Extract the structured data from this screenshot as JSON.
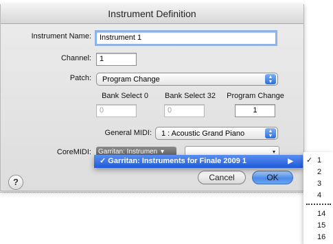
{
  "dialog": {
    "title": "Instrument Definition",
    "instrument_name_label": "Instrument Name:",
    "instrument_name_value": "Instrument 1",
    "channel_label": "Channel:",
    "channel_value": "1",
    "patch_label": "Patch:",
    "patch_value": "Program Change",
    "bank_select0_label": "Bank Select 0",
    "bank_select0_value": "0",
    "bank_select32_label": "Bank Select 32",
    "bank_select32_value": "0",
    "program_change_label": "Program Change",
    "program_change_value": "1",
    "general_midi_label": "General MIDI:",
    "general_midi_value": "1 : Acoustic Grand Piano",
    "coremidi_label": "CoreMIDI:",
    "coremidi_value": "Garritan: Instrumen",
    "coremidi_caret": "▾",
    "coremidi_secondary_caret": "▾",
    "help_label": "?",
    "cancel_label": "Cancel",
    "ok_label": "OK"
  },
  "menu_device": {
    "item_label": "✓ Garritan: Instruments for Finale 2009 1",
    "submenu_arrow": "▶"
  },
  "menu_port": {
    "checkmark": "✓",
    "items": [
      "1",
      "2",
      "3",
      "4",
      "14",
      "15",
      "16"
    ]
  },
  "icons": {
    "popup_arrows": "▲▼"
  },
  "colors": {
    "accent": "#2c6fdb",
    "menu_highlight": "#1f5ad8"
  }
}
